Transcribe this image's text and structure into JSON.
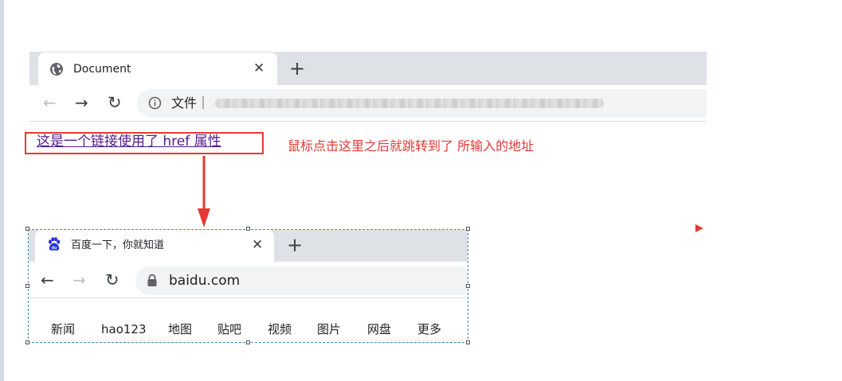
{
  "top_browser": {
    "tab_title": "Document",
    "close_glyph": "✕",
    "new_tab_glyph": "+",
    "back_glyph": "←",
    "forward_glyph": "→",
    "reload_glyph": "↻",
    "file_label": "文件｜",
    "tab_icon": "globe-icon"
  },
  "link": {
    "text": "这是一个链接使用了 href 属性"
  },
  "annotation": {
    "text": "鼠标点击这里之后就跳转到了 所输入的地址",
    "color": "#e53935"
  },
  "bottom_browser": {
    "tab_title": "百度一下，你就知道",
    "close_glyph": "✕",
    "new_tab_glyph": "+",
    "back_glyph": "←",
    "forward_glyph": "→",
    "reload_glyph": "↻",
    "url": "baidu.com",
    "tab_icon": "baidu-paw-icon",
    "nav": [
      "新闻",
      "hao123",
      "地图",
      "贴吧",
      "视频",
      "图片",
      "网盘",
      "更多"
    ]
  }
}
